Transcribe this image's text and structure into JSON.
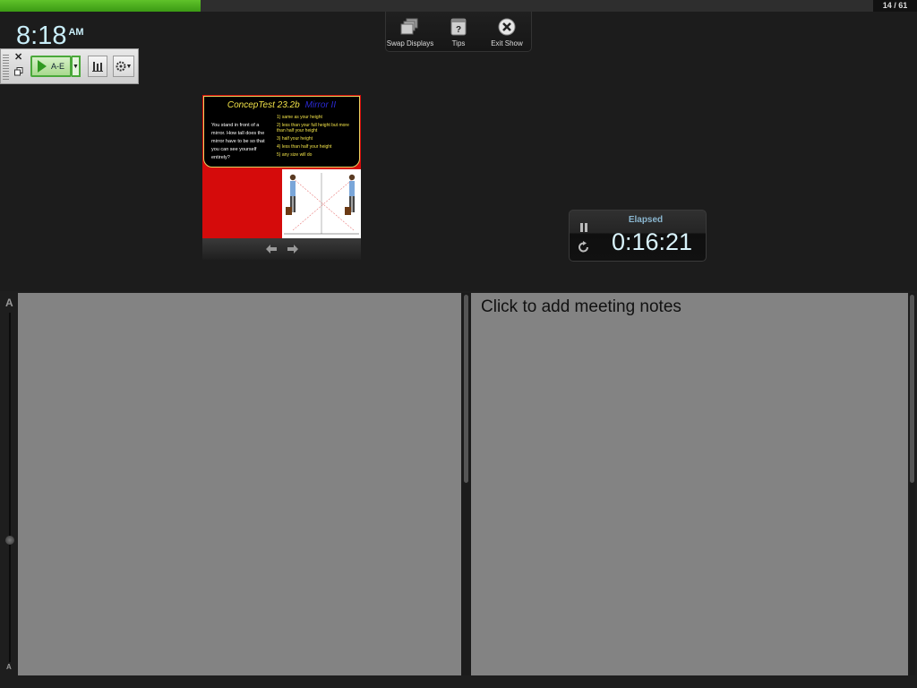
{
  "progress": {
    "current": 14,
    "total": 61,
    "label": "14 / 61",
    "fraction": 0.2295,
    "fill_color": "#4aab1f"
  },
  "clock": {
    "time": "8:18",
    "ampm": "AM"
  },
  "top_toolbar": {
    "swap_label": "Swap Displays",
    "tips_label": "Tips",
    "exit_label": "Exit Show"
  },
  "clicker_bar": {
    "start_label": "A-E",
    "icons": [
      "close-icon",
      "copy-icon",
      "play-icon",
      "dropdown-arrow-icon",
      "bar-chart-icon",
      "settings-icon"
    ]
  },
  "slide": {
    "title": "ConcepTest 23.2b",
    "subtitle": "Mirror II",
    "question": "You stand in front of a mirror.  How tall does the mirror have to be so that you can see yourself entirely?",
    "answers": [
      "1)  same as your height",
      "2)  less than your full height but more than half your height",
      "3)  half your height",
      "4)  less than half your height",
      "5)  any size will do"
    ]
  },
  "timer": {
    "label": "Elapsed",
    "value": "0:16:21"
  },
  "zoom": {
    "large_label": "A",
    "small_label": "A"
  },
  "notes": {
    "placeholder": "Click to add meeting notes"
  }
}
